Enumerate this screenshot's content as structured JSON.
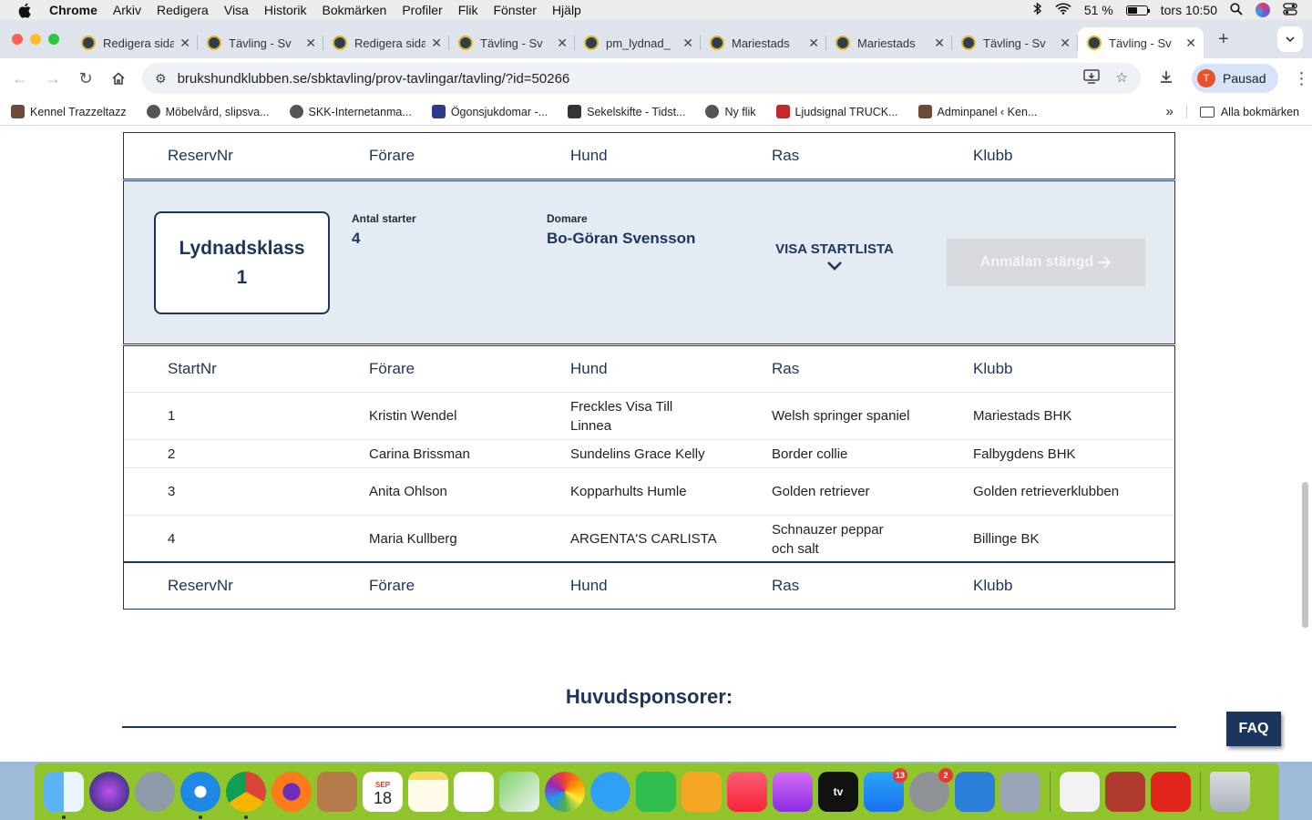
{
  "menubar": {
    "app": "Chrome",
    "items": [
      "Arkiv",
      "Redigera",
      "Visa",
      "Historik",
      "Bokmärken",
      "Profiler",
      "Flik",
      "Fönster",
      "Hjälp"
    ],
    "battery": "51 %",
    "battery_level": 0.51,
    "clock": "tors 10:50"
  },
  "tabs": [
    {
      "title": "Redigera sida"
    },
    {
      "title": "Tävling - Sv"
    },
    {
      "title": "Redigera sida"
    },
    {
      "title": "Tävling - Sv"
    },
    {
      "title": "pm_lydnad_"
    },
    {
      "title": "Mariestads"
    },
    {
      "title": "Mariestads"
    },
    {
      "title": "Tävling - Sv"
    },
    {
      "title": "Tävling - Sv"
    }
  ],
  "address": {
    "url": "brukshundklubben.se/sbktavling/prov-tavlingar/tavling/?id=50266"
  },
  "profile": {
    "initial": "T",
    "label": "Pausad"
  },
  "bookmarks": {
    "items": [
      "Kennel Trazzeltazz",
      "Möbelvård, slipsva...",
      "SKK-Internetanma...",
      "Ögonsjukdomar -...",
      "Sekelskifte - Tidst...",
      "Ny flik",
      "Ljudsignal TRUCK...",
      "Adminpanel ‹ Ken..."
    ],
    "all": "Alla bokmärken"
  },
  "columns": {
    "reserv": "ReservNr",
    "start": "StartNr",
    "forare": "Förare",
    "hund": "Hund",
    "ras": "Ras",
    "klubb": "Klubb"
  },
  "class": {
    "name": "Lydnadsklass 1",
    "antal_label": "Antal starter",
    "antal_value": "4",
    "domare_label": "Domare",
    "domare_value": "Bo-Göran Svensson",
    "visa": "VISA STARTLISTA",
    "anmalan": "Anmälan stängd"
  },
  "startlist": [
    {
      "nr": "1",
      "forare": "Kristin Wendel",
      "hund": "Freckles Visa Till Linnea",
      "ras": "Welsh springer spaniel",
      "klubb": "Mariestads BHK"
    },
    {
      "nr": "2",
      "forare": "Carina Brissman",
      "hund": "Sundelins Grace Kelly",
      "ras": "Border collie",
      "klubb": "Falbygdens BHK"
    },
    {
      "nr": "3",
      "forare": "Anita Ohlson",
      "hund": "Kopparhults Humle",
      "ras": "Golden retriever",
      "klubb": "Golden retrieverklubben"
    },
    {
      "nr": "4",
      "forare": "Maria Kullberg",
      "hund": "ARGENTA'S CARLISTA",
      "ras": "Schnauzer peppar och salt",
      "klubb": "Billinge BK"
    }
  ],
  "sponsors_heading": "Huvudsponsorer:",
  "faq": "FAQ",
  "dock": {
    "calendar_month": "SEP",
    "calendar_day": "18",
    "appstore_badge": "13",
    "settings_badge": "2",
    "tv_label": "tv"
  }
}
